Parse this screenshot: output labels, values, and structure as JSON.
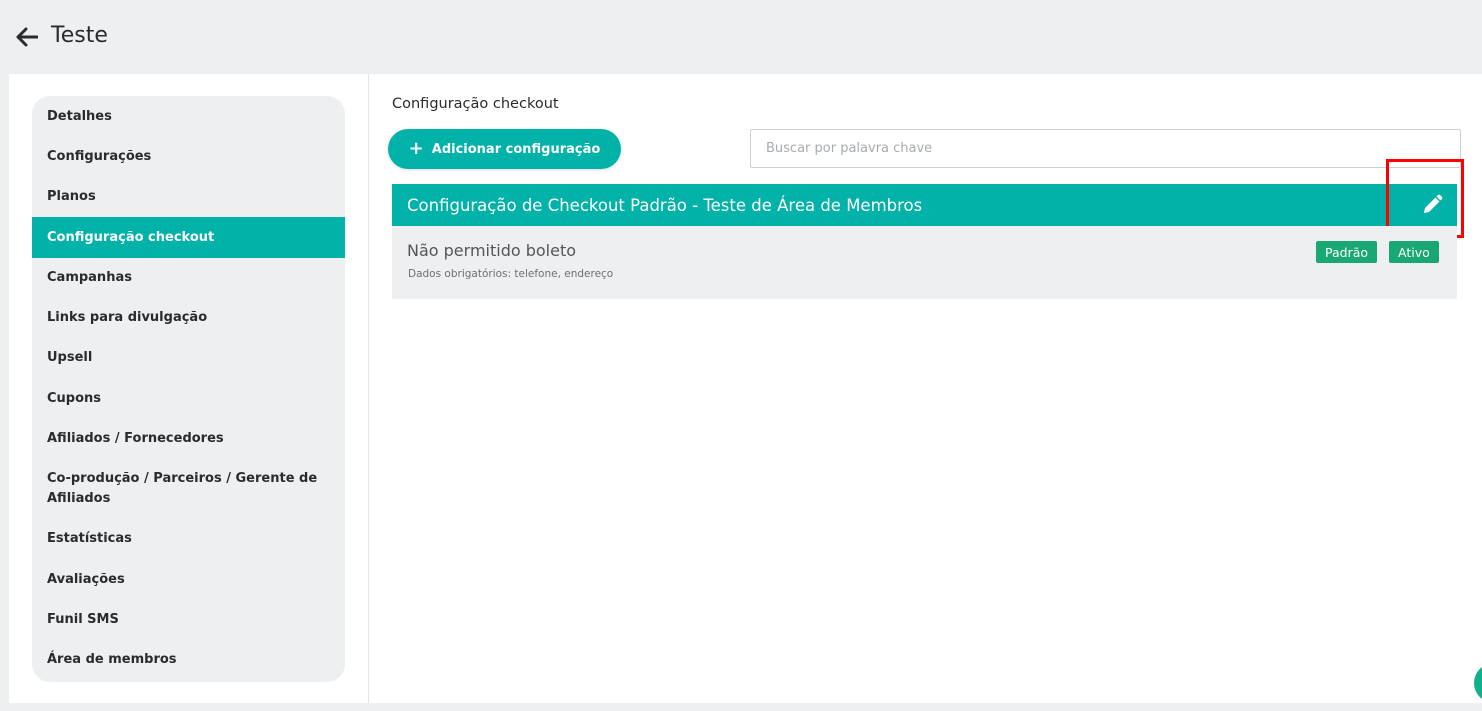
{
  "header": {
    "title": "Teste",
    "back_icon": "arrow-left-icon"
  },
  "sidebar": {
    "items": [
      {
        "label": "Detalhes",
        "active": false
      },
      {
        "label": "Configurações",
        "active": false
      },
      {
        "label": "Planos",
        "active": false
      },
      {
        "label": "Configuração checkout",
        "active": true
      },
      {
        "label": "Campanhas",
        "active": false
      },
      {
        "label": "Links para divulgação",
        "active": false
      },
      {
        "label": "Upsell",
        "active": false
      },
      {
        "label": "Cupons",
        "active": false
      },
      {
        "label": "Afiliados / Fornecedores",
        "active": false
      },
      {
        "label": "Co-produção / Parceiros / Gerente de Afiliados",
        "active": false
      },
      {
        "label": "Estatísticas",
        "active": false
      },
      {
        "label": "Avaliações",
        "active": false
      },
      {
        "label": "Funil SMS",
        "active": false
      },
      {
        "label": "Área de membros",
        "active": false
      }
    ]
  },
  "main": {
    "section_title": "Configuração checkout",
    "add_button": {
      "icon": "plus-icon",
      "label": "Adicionar configuração"
    },
    "search": {
      "placeholder": "Buscar por palavra chave",
      "value": ""
    },
    "configs": [
      {
        "title": "Configuração de Checkout Padrão - Teste de Área de Membros",
        "edit_icon": "pencil-icon",
        "name": "Não permitido boleto",
        "details": "Dados obrigatórios: telefone, endereço",
        "badges": [
          "Padrão",
          "Ativo"
        ]
      }
    ]
  },
  "colors": {
    "accent": "#01b2a8",
    "badge": "#19a874",
    "highlight": "#ff0000",
    "background": "#eeeff1"
  }
}
